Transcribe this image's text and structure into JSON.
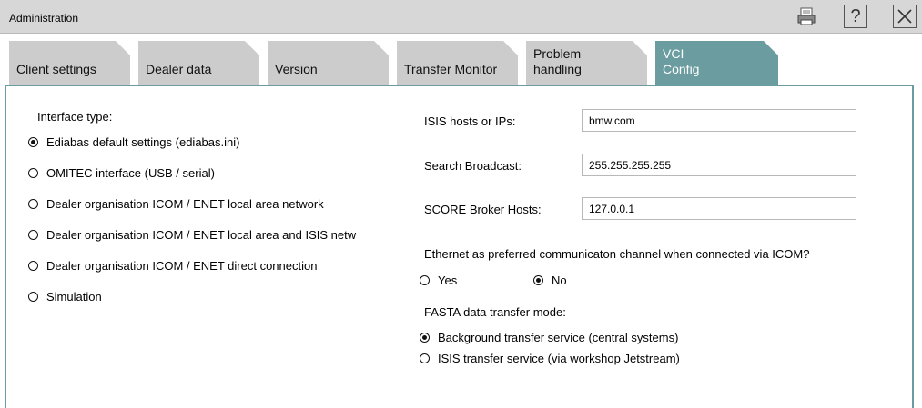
{
  "window": {
    "title": "Administration"
  },
  "titlebar_icons": [
    "printer-icon",
    "help-icon",
    "close-icon"
  ],
  "help_glyph": "?",
  "tabs": [
    {
      "label": "Client settings",
      "active": false
    },
    {
      "label": "Dealer data",
      "active": false
    },
    {
      "label": "Version",
      "active": false
    },
    {
      "label": "Transfer Monitor",
      "active": false
    },
    {
      "label": "Problem\nhandling",
      "active": false
    },
    {
      "label": "VCI\nConfig",
      "active": true
    }
  ],
  "interface": {
    "heading": "Interface type:",
    "options": [
      {
        "label": "Ediabas default settings (ediabas.ini)",
        "selected": true
      },
      {
        "label": "OMITEC interface (USB / serial)",
        "selected": false
      },
      {
        "label": "Dealer organisation ICOM / ENET local area network",
        "selected": false
      },
      {
        "label": "Dealer organisation ICOM / ENET local area and ISIS netw",
        "selected": false
      },
      {
        "label": "Dealer organisation ICOM / ENET direct connection",
        "selected": false
      },
      {
        "label": "Simulation",
        "selected": false
      }
    ]
  },
  "network": {
    "isis_hosts_label": "ISIS hosts or IPs:",
    "isis_hosts_value": "bmw.com",
    "search_broadcast_label": "Search Broadcast:",
    "search_broadcast_value": "255.255.255.255",
    "score_broker_label": "SCORE Broker Hosts:",
    "score_broker_value": "127.0.0.1"
  },
  "ethernet": {
    "question": "Ethernet as preferred communicaton channel when connected via ICOM?",
    "yes_label": "Yes",
    "no_label": "No",
    "selected": "No"
  },
  "fasta": {
    "heading": "FASTA data transfer mode:",
    "options": [
      {
        "label": "Background transfer service (central systems)",
        "selected": true
      },
      {
        "label": "ISIS transfer service (via workshop Jetstream)",
        "selected": false
      }
    ]
  },
  "colors": {
    "accent": "#6a9ca0",
    "tab_inactive": "#cccccc",
    "titlebar": "#d7d7d7"
  }
}
